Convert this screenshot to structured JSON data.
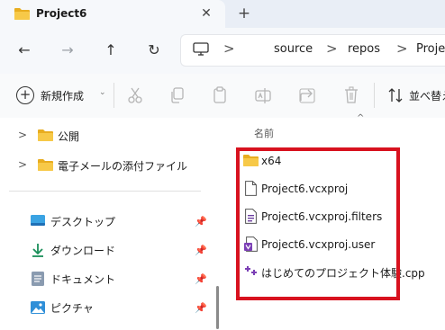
{
  "tab": {
    "title": "Project6",
    "close": "✕",
    "new_tab": "+"
  },
  "nav": {
    "back": "←",
    "forward": "→",
    "up": "↑",
    "refresh": "↻"
  },
  "address": {
    "separator": ">",
    "crumbs": [
      "source",
      "repos",
      "Proje"
    ]
  },
  "commands": {
    "new_label": "新規作成",
    "new_plus": "+",
    "sort_label": "並べ替え",
    "chevron": "⌄"
  },
  "sidebar": {
    "expand_chevron": ">",
    "pin": "📌",
    "top_items": [
      {
        "label": "公開"
      },
      {
        "label": "電子メールの添付ファイル"
      }
    ],
    "quick_access": [
      {
        "label": "デスクトップ",
        "icon": "desktop-icon"
      },
      {
        "label": "ダウンロード",
        "icon": "download-icon"
      },
      {
        "label": "ドキュメント",
        "icon": "document-icon"
      },
      {
        "label": "ピクチャ",
        "icon": "pictures-icon"
      }
    ]
  },
  "content": {
    "column_name": "名前",
    "sort_chevron": "^",
    "files": [
      {
        "name": "x64",
        "icon": "folder-icon"
      },
      {
        "name": "Project6.vcxproj",
        "icon": "file-icon"
      },
      {
        "name": "Project6.vcxproj.filters",
        "icon": "filters-file-icon"
      },
      {
        "name": "Project6.vcxproj.user",
        "icon": "vs-user-file-icon"
      },
      {
        "name": "はじめてのプロジェクト体験.cpp",
        "icon": "cpp-file-icon"
      }
    ]
  },
  "colors": {
    "folder": "#f5c542",
    "highlight": "#d8121f",
    "accent_download": "#1a8f5a",
    "vs_purple": "#7b3fb5"
  }
}
